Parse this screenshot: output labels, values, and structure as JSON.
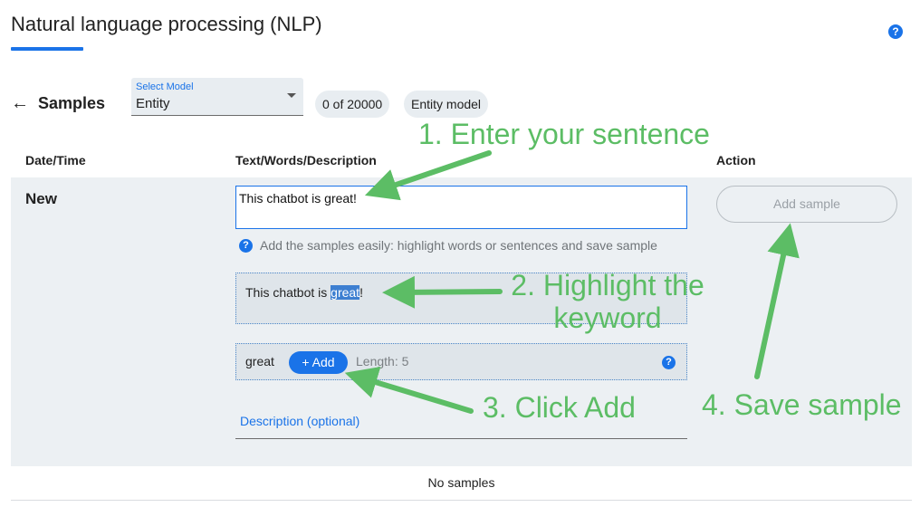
{
  "page": {
    "title": "Natural language processing (NLP)",
    "help_icon": "question-circle-icon",
    "accent_color": "#1a73e8"
  },
  "toolbar": {
    "back_icon": "arrow-left-icon",
    "samples_label": "Samples",
    "model_select": {
      "label": "Select Model",
      "value": "Entity"
    },
    "sample_count_chip": "0 of 20000",
    "model_type_chip": "Entity model"
  },
  "table": {
    "headers": {
      "date_time": "Date/Time",
      "text": "Text/Words/Description",
      "action": "Action"
    },
    "new_row": {
      "label": "New",
      "sentence_value": "This chatbot is great!",
      "help_text": "Add the samples easily: highlight words or sentences and save sample",
      "highlight": {
        "before": "This chatbot is ",
        "selected": "great",
        "after": "!"
      },
      "keyword": {
        "word": "great",
        "add_label": "+ Add",
        "length_text": "Length: 5"
      },
      "description_placeholder": "Description (optional)",
      "add_sample_label": "Add sample"
    },
    "empty_text": "No samples"
  },
  "annotations": {
    "color": "#5cbd65",
    "step1": "1. Enter your sentence",
    "step2": "2. Highlight the keyword",
    "step3": "3. Click Add",
    "step4": "4. Save sample"
  }
}
